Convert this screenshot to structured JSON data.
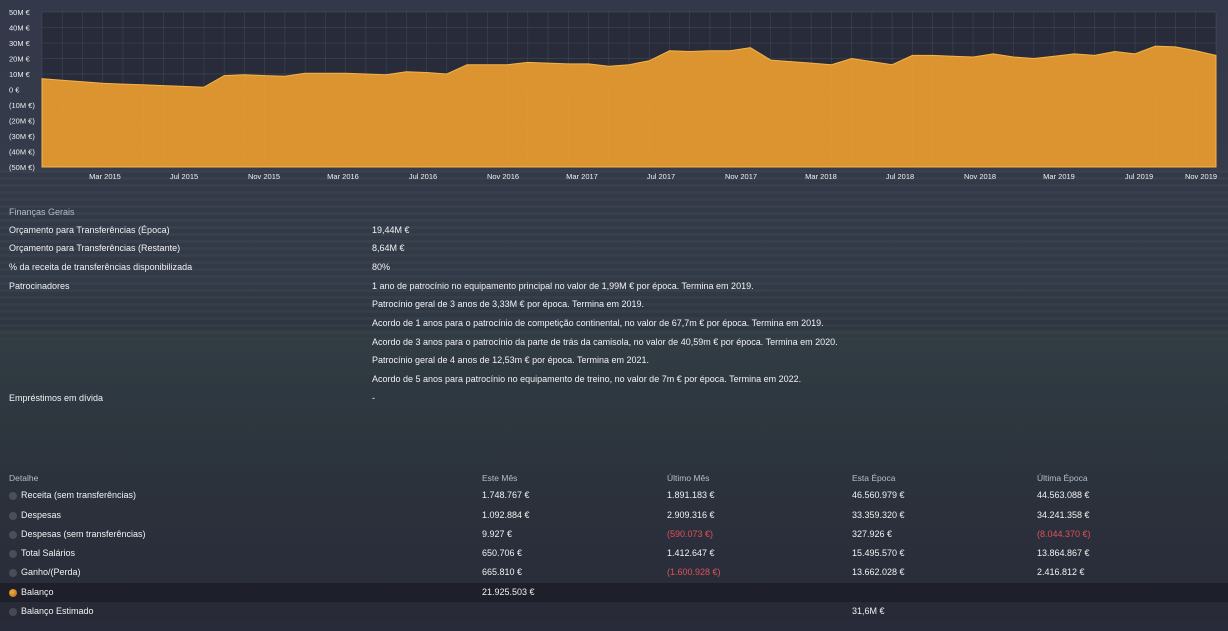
{
  "chart_data": {
    "type": "area",
    "y_ticks": [
      "50M €",
      "40M €",
      "30M €",
      "20M €",
      "10M €",
      "0 €",
      "(10M €)",
      "(20M €)",
      "(30M €)",
      "(40M €)",
      "(50M €)"
    ],
    "ylim": [
      -50,
      50
    ],
    "x_ticks": [
      "Mar 2015",
      "Jul 2015",
      "Nov 2015",
      "Mar 2016",
      "Jul 2016",
      "Nov 2016",
      "Mar 2017",
      "Jul 2017",
      "Nov 2017",
      "Mar 2018",
      "Jul 2018",
      "Nov 2018",
      "Mar 2019",
      "Jul 2019",
      "Nov 2019"
    ],
    "fill_color": "#f0a030",
    "grid": true,
    "values": [
      7,
      6,
      5,
      4,
      3.5,
      3,
      2.5,
      2,
      1.5,
      9,
      9.5,
      9,
      8.5,
      10.5,
      10.5,
      10.5,
      10,
      9.5,
      11.5,
      11,
      10,
      16,
      16,
      16,
      17.5,
      17,
      16.5,
      16.5,
      15,
      16,
      18.5,
      25,
      24.5,
      25,
      25,
      27,
      19,
      18,
      17,
      16,
      20,
      18,
      16,
      22,
      22,
      21.5,
      21,
      23,
      21,
      20,
      21.5,
      23,
      22,
      24.5,
      23,
      28,
      27.5,
      25,
      22
    ]
  },
  "finance": {
    "section_title": "Finanças Gerais",
    "rows": [
      {
        "label": "Orçamento para Transferências (Época)",
        "value": "19,44M €"
      },
      {
        "label": "Orçamento para Transferências (Restante)",
        "value": "8,64M €"
      },
      {
        "label": "% da receita de transferências disponibilizada",
        "value": "80%"
      }
    ],
    "sponsors_label": "Patrocinadores",
    "sponsors": [
      "1 ano de patrocínio no equipamento principal no valor de 1,99M € por época. Termina em 2019.",
      "Patrocínio geral de 3 anos de 3,33M € por época. Termina em 2019.",
      "Acordo de 1 anos para o patrocínio de competição continental, no valor de 67,7m € por época. Termina em 2019.",
      "Acordo de 3 anos para o patrocínio da parte de trás da camisola, no valor de 40,59m € por época. Termina em 2020.",
      "Patrocínio geral de 4 anos de 12,53m € por época. Termina em 2021.",
      "Acordo de 5 anos para patrocínio no equipamento de treino, no valor de 7m € por época. Termina em 2022."
    ],
    "loans_label": "Empréstimos em dívida",
    "loans_value": "-"
  },
  "table": {
    "headers": [
      "Detalhe",
      "Este Mês",
      "Último Mês",
      "Esta Época",
      "Última Época"
    ],
    "rows": [
      {
        "label": "Receita (sem transferências)",
        "c1": "1.748.767 €",
        "c2": "1.891.183 €",
        "c3": "46.560.979 €",
        "c4": "44.563.088 €"
      },
      {
        "label": "Despesas",
        "c1": "1.092.884 €",
        "c2": "2.909.316 €",
        "c3": "33.359.320 €",
        "c4": "34.241.358 €"
      },
      {
        "label": "Despesas (sem transferências)",
        "c1": "9.927 €",
        "c2": "(590.073 €)",
        "c3": "327.926 €",
        "c4": "(8.044.370 €)"
      },
      {
        "label": "Total Salários",
        "c1": "650.706 €",
        "c2": "1.412.647 €",
        "c3": "15.495.570 €",
        "c4": "13.864.867 €"
      },
      {
        "label": "Ganho/(Perda)",
        "c1": "665.810 €",
        "c2": "(1.600.928 €)",
        "c3": "13.662.028 €",
        "c4": "2.416.812 €"
      },
      {
        "label": "Balanço",
        "c1": "21.925.503 €",
        "c2": "",
        "c3": "",
        "c4": ""
      },
      {
        "label": "Balanço Estimado",
        "c1": "",
        "c2": "",
        "c3": "31,6M €",
        "c4": ""
      }
    ],
    "negative_color": "#e0505a"
  }
}
